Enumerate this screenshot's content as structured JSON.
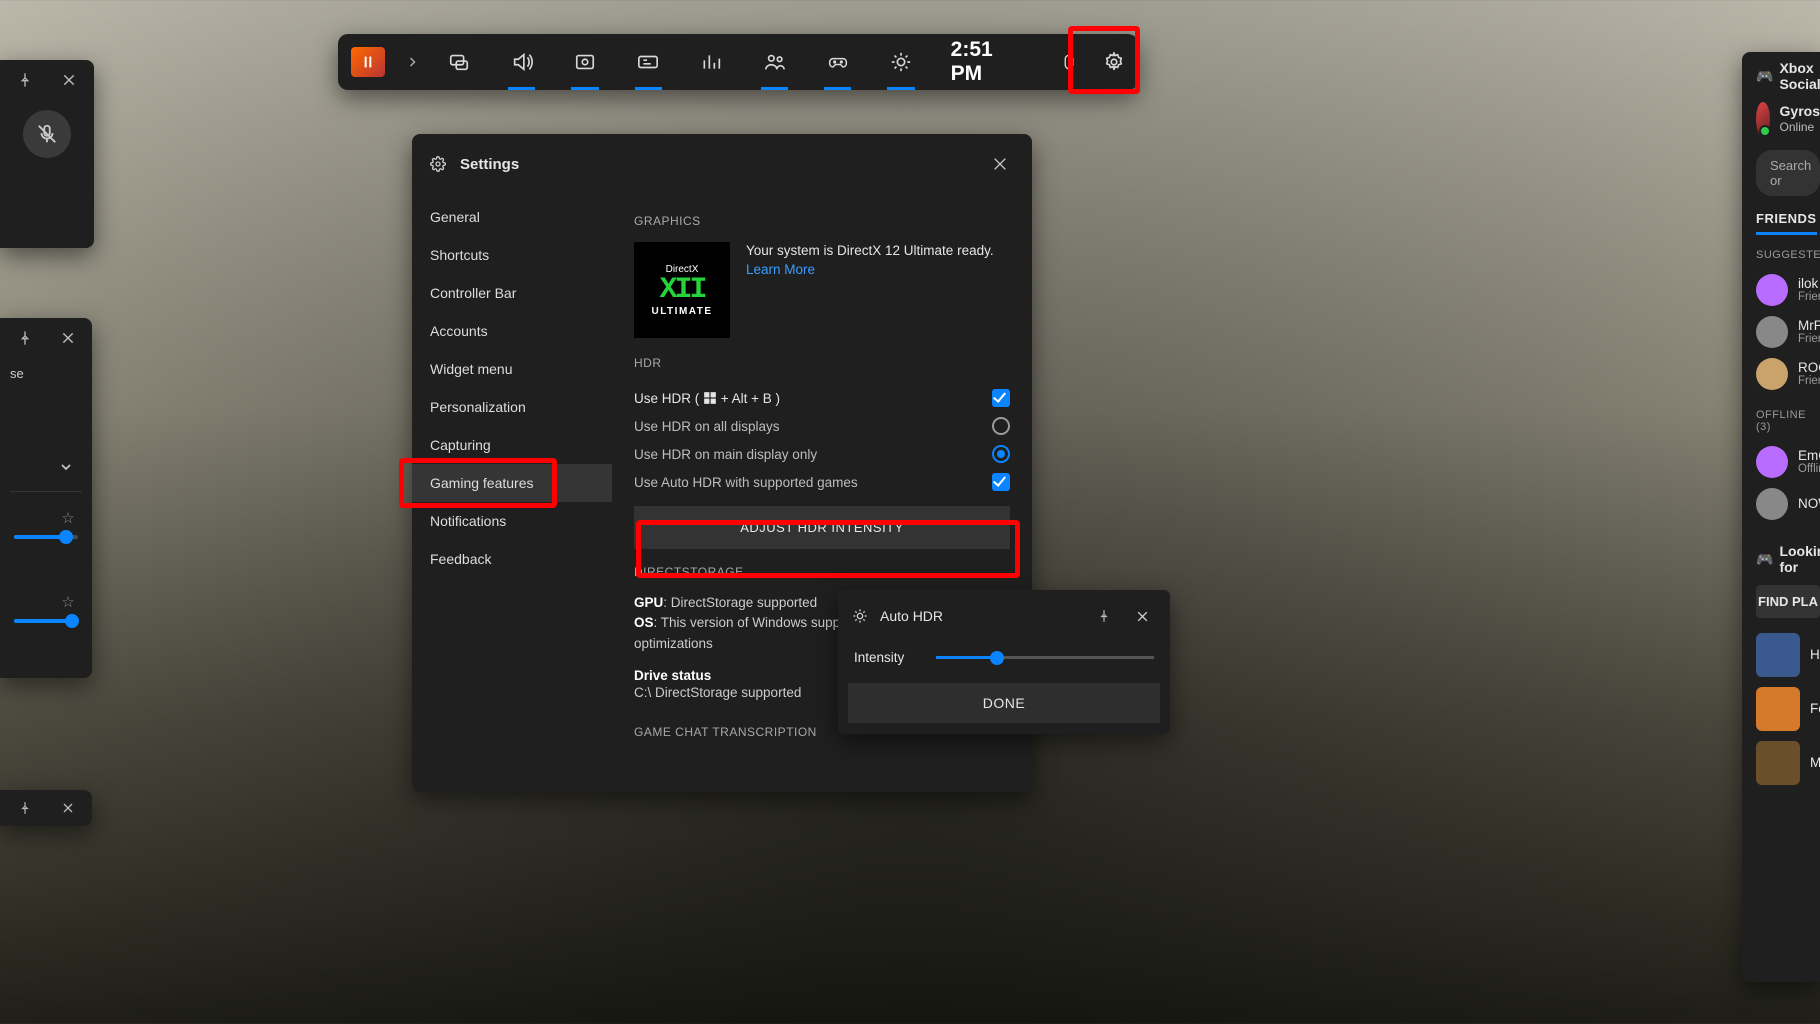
{
  "topbar": {
    "time": "2:51 PM",
    "items": [
      {
        "name": "app-switch",
        "icon": "app",
        "active": false
      },
      {
        "name": "chevron",
        "icon": "chev",
        "active": false
      },
      {
        "name": "widgets",
        "icon": "layers",
        "active": false
      },
      {
        "name": "audio",
        "icon": "volume",
        "active": true
      },
      {
        "name": "capture",
        "icon": "capture",
        "active": true
      },
      {
        "name": "overlay",
        "icon": "overlay",
        "active": true
      },
      {
        "name": "performance",
        "icon": "perf",
        "active": false
      },
      {
        "name": "social",
        "icon": "people",
        "active": true
      },
      {
        "name": "xbox",
        "icon": "controller",
        "active": true
      },
      {
        "name": "brightness",
        "icon": "sun",
        "active": true
      }
    ],
    "mouse_icon": "mouse",
    "settings_icon": "gear"
  },
  "mic_widget": {
    "muted": true
  },
  "audio_widget": {
    "mix_label": "se",
    "sliders": [
      {
        "pct": 82
      },
      {
        "pct": 90
      }
    ]
  },
  "settings": {
    "title": "Settings",
    "nav": [
      {
        "label": "General",
        "sel": false
      },
      {
        "label": "Shortcuts",
        "sel": false
      },
      {
        "label": "Controller Bar",
        "sel": false
      },
      {
        "label": "Accounts",
        "sel": false
      },
      {
        "label": "Widget menu",
        "sel": false
      },
      {
        "label": "Personalization",
        "sel": false
      },
      {
        "label": "Capturing",
        "sel": false
      },
      {
        "label": "Gaming features",
        "sel": true
      },
      {
        "label": "Notifications",
        "sel": false
      },
      {
        "label": "Feedback",
        "sel": false
      }
    ],
    "graphics": {
      "heading": "GRAPHICS",
      "badge_top": "DirectX",
      "badge_mid": "XII",
      "badge_bot": "ULTIMATE",
      "text": "Your system is DirectX 12 Ultimate ready.",
      "learn": "Learn More"
    },
    "hdr": {
      "heading": "HDR",
      "use_hdr_pre": "Use HDR ( ",
      "use_hdr_post": " + Alt + B )",
      "opt_all": "Use HDR on all displays",
      "opt_main": "Use HDR on main display only",
      "opt_auto": "Use Auto HDR with supported games",
      "adjust": "ADJUST HDR INTENSITY"
    },
    "ds": {
      "heading": "DIRECTSTORAGE",
      "gpu_k": "GPU",
      "gpu_v": ": DirectStorage supported",
      "os_k": "OS",
      "os_v": ": This version of Windows supports DirectStorage IO optimizations",
      "drive_h": "Drive status",
      "drive_v": "C:\\ DirectStorage supported"
    },
    "chat": {
      "heading": "GAME CHAT TRANSCRIPTION"
    }
  },
  "hdrpop": {
    "title": "Auto HDR",
    "intensity_label": "Intensity",
    "intensity_pct": 28,
    "done": "DONE"
  },
  "social": {
    "header": "Xbox Social",
    "me": {
      "name": "Gyros",
      "status": "Online"
    },
    "search": "Search or",
    "tab": "FRIENDS",
    "suggested_h": "SUGGESTED",
    "suggested": [
      {
        "name": "ilok",
        "sub": "Friend"
      },
      {
        "name": "MrP",
        "sub": "Friend"
      },
      {
        "name": "ROG",
        "sub": "Friend"
      }
    ],
    "offline_h": "OFFLINE  (3)",
    "offline": [
      {
        "name": "EmCe",
        "sub": "Offline"
      },
      {
        "name": "NOW",
        "sub": ""
      }
    ],
    "lfg_h": "Looking for",
    "find": "FIND PLA",
    "games": [
      {
        "name": "Ha"
      },
      {
        "name": "Fo"
      },
      {
        "name": "Mi"
      }
    ]
  }
}
